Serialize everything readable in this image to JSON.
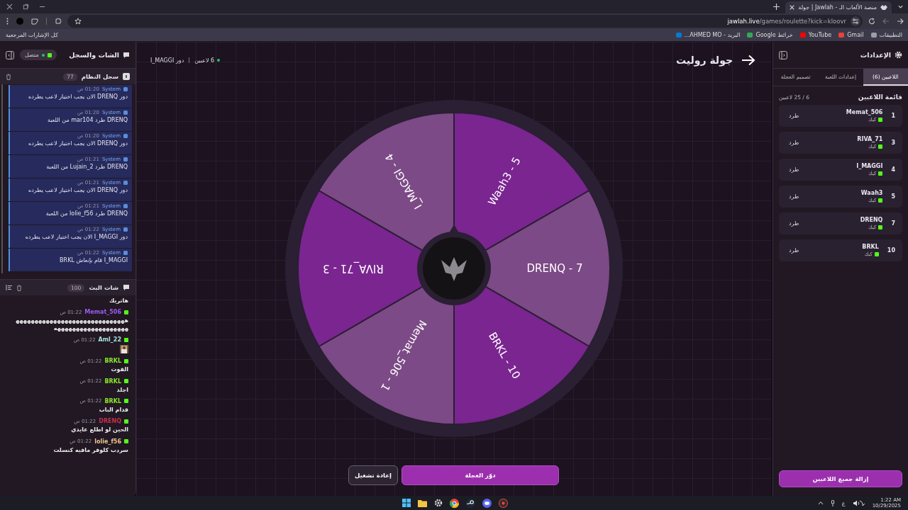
{
  "browser": {
    "tab_title": "جولة | Jawlah - منصة الألعاب الـ",
    "url_host": "jawlah.live",
    "url_path": "/games/roulette?kick=kloovr",
    "bookmarks": [
      {
        "label": "التطبيقات",
        "kind": "apps"
      },
      {
        "label": "Gmail",
        "kind": "mail"
      },
      {
        "label": "YouTube",
        "kind": "video"
      },
      {
        "label": "خرائط Google",
        "kind": "maps"
      },
      {
        "label": "البريد - AHMED MO...",
        "kind": "outlook"
      }
    ],
    "all_bookmarks": "كل الإشارات المرجعية"
  },
  "chat_panel": {
    "title": "الشات والسجل",
    "status": "متصل",
    "system_log": {
      "title": "سجل النظام",
      "count": "77",
      "entries": [
        {
          "sender": "System",
          "time": "01:20 ص",
          "text": "دور DRENQ الان يجب اختيار لاعب يطرده"
        },
        {
          "sender": "System",
          "time": "01:20 ص",
          "text": "DRENQ طرد mar104 من اللعبة"
        },
        {
          "sender": "System",
          "time": "01:20 ص",
          "text": "دور DRENQ الان يجب اختيار لاعب يطرده"
        },
        {
          "sender": "System",
          "time": "01:21 ص",
          "text": "DRENQ طرد Lujain_2 من اللعبة"
        },
        {
          "sender": "System",
          "time": "01:21 ص",
          "text": "دور DRENQ الان يجب اختيار لاعب يطرده"
        },
        {
          "sender": "System",
          "time": "01:21 ص",
          "text": "DRENQ طرد lolie_f56 من اللعبة"
        },
        {
          "sender": "System",
          "time": "01:22 ص",
          "text": "دور I_MAGGI الان يجب اختيار لاعب يطرده"
        },
        {
          "sender": "System",
          "time": "01:22 ص",
          "text": "I_MAGGI قام بإنعاش BRKL"
        }
      ]
    },
    "chat": {
      "title": "شات البث",
      "count": "100",
      "messages": [
        {
          "kind": "continuation",
          "text": "هاتريك"
        },
        {
          "kind": "text",
          "user": "Memat_506",
          "color": "#9b5cf0",
          "time": "01:22 ص",
          "text": "هههههههههههههههههههههههههههههههههههههههههههههههههه"
        },
        {
          "kind": "sticker",
          "user": "Aml_22",
          "color": "#a6e3dc",
          "time": "01:22 ص"
        },
        {
          "kind": "text",
          "user": "BRKL",
          "color": "#8ce62a",
          "time": "01:22 ص",
          "text": "القوت"
        },
        {
          "kind": "text",
          "user": "BRKL",
          "color": "#8ce62a",
          "time": "01:22 ص",
          "text": "اجلد"
        },
        {
          "kind": "text",
          "user": "BRKL",
          "color": "#8ce62a",
          "time": "01:22 ص",
          "text": "قدام الباب"
        },
        {
          "kind": "text",
          "user": "DRENQ",
          "color": "#c2304e",
          "time": "01:22 ص",
          "text": "الحين لو اطلع عايدي"
        },
        {
          "kind": "text",
          "user": "lolie_f56",
          "color": "#eec58c",
          "time": "01:22 ص",
          "text": "سردب كلوفر مافيه كنسلت"
        }
      ]
    }
  },
  "game": {
    "title": "جولة روليت",
    "players_count": "6 لاعبين",
    "turn": "دور I_MAGGI",
    "segments": [
      {
        "label": "Waah3 - 5",
        "color": "#7a2590"
      },
      {
        "label": "DRENQ - 7",
        "color": "#7c4a86"
      },
      {
        "label": "BRKL - 10",
        "color": "#7a2590"
      },
      {
        "label": "Memat_506 - 1",
        "color": "#7c4a86"
      },
      {
        "label": "RIVA_71 - 3",
        "color": "#7a2590"
      },
      {
        "label": "I_MAGGI - 4",
        "color": "#7c4a86"
      }
    ],
    "buttons": [
      {
        "label": "دوّر العجلة",
        "kind": "primary"
      },
      {
        "label": "إعادة تشغيل",
        "kind": "secondary"
      }
    ]
  },
  "settings_panel": {
    "title": "الإعدادات",
    "tabs": [
      {
        "label": "اللاعبين (6)",
        "selected": true
      },
      {
        "label": "إعدادات اللعبة",
        "selected": false
      },
      {
        "label": "تصميم العجلة",
        "selected": false
      }
    ],
    "list_title": "قائمة اللاعبين",
    "list_count": "6 / 25 لاعبين",
    "players": [
      {
        "number": "1",
        "name": "Memat_506",
        "platform": "كيك",
        "action": "طرد"
      },
      {
        "number": "3",
        "name": "RIVA_71",
        "platform": "كيك",
        "action": "طرد"
      },
      {
        "number": "4",
        "name": "I_MAGGI",
        "platform": "كيك",
        "action": "طرد"
      },
      {
        "number": "5",
        "name": "Waah3",
        "platform": "كيك",
        "action": "طرد"
      },
      {
        "number": "7",
        "name": "DRENQ",
        "platform": "كيك",
        "action": "طرد"
      },
      {
        "number": "10",
        "name": "BRKL",
        "platform": "كيك",
        "action": "طرد"
      }
    ],
    "remove_all": "إزالة جميع اللاعبين"
  },
  "taskbar": {
    "language": "ع",
    "time": "1:22 AM",
    "date": "10/29/2025"
  }
}
